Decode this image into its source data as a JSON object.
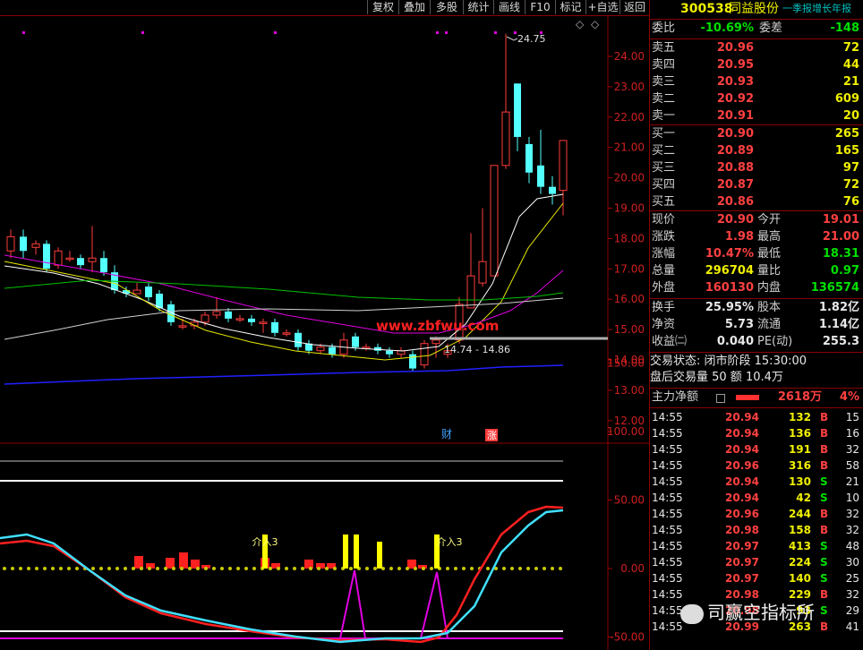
{
  "toolbar": [
    "复权",
    "叠加",
    "多股",
    "统计",
    "画线",
    "F10",
    "标记",
    "+自选",
    "返回"
  ],
  "header": {
    "code": "300538",
    "name": "同益股份",
    "subtitle": "一季报增长年报"
  },
  "quote": {
    "wei_bi_label": "委比",
    "wei_bi": "-10.69%",
    "wei_cha_label": "委差",
    "wei_cha": "-148",
    "asks": [
      {
        "label": "卖五",
        "price": "20.96",
        "vol": "72"
      },
      {
        "label": "卖四",
        "price": "20.95",
        "vol": "44"
      },
      {
        "label": "卖三",
        "price": "20.93",
        "vol": "21"
      },
      {
        "label": "卖二",
        "price": "20.92",
        "vol": "609"
      },
      {
        "label": "卖一",
        "price": "20.91",
        "vol": "20"
      }
    ],
    "bids": [
      {
        "label": "买一",
        "price": "20.90",
        "vol": "265"
      },
      {
        "label": "买二",
        "price": "20.89",
        "vol": "165"
      },
      {
        "label": "买三",
        "price": "20.88",
        "vol": "97"
      },
      {
        "label": "买四",
        "price": "20.87",
        "vol": "72"
      },
      {
        "label": "买五",
        "price": "20.86",
        "vol": "76"
      }
    ],
    "stats": [
      {
        "l1": "现价",
        "v1": "20.90",
        "c1": "red",
        "l2": "今开",
        "v2": "19.01",
        "c2": "red"
      },
      {
        "l1": "涨跌",
        "v1": "1.98",
        "c1": "red",
        "l2": "最高",
        "v2": "21.00",
        "c2": "red"
      },
      {
        "l1": "涨幅",
        "v1": "10.47%",
        "c1": "red",
        "l2": "最低",
        "v2": "18.31",
        "c2": "green"
      },
      {
        "l1": "总量",
        "v1": "296704",
        "c1": "yellow",
        "l2": "量比",
        "v2": "0.97",
        "c2": "green"
      },
      {
        "l1": "外盘",
        "v1": "160130",
        "c1": "red",
        "l2": "内盘",
        "v2": "136574",
        "c2": "green"
      }
    ],
    "stats2": [
      {
        "l1": "换手",
        "v1": "25.95%",
        "l2": "股本",
        "v2": "1.82亿"
      },
      {
        "l1": "净资",
        "v1": "5.73",
        "l2": "流通",
        "v2": "1.14亿"
      },
      {
        "l1": "收益㈡",
        "v1": "0.040",
        "l2": "PE(动)",
        "v2": "255.3"
      }
    ],
    "trade_state": "交易状态: 闭市阶段 15:30:00",
    "after_hours": "盘后交易量 50 额 10.4万",
    "main_force_label": "主力净额",
    "main_force_value": "2618万",
    "main_force_pct": "4%"
  },
  "ticks": [
    {
      "t": "14:55",
      "p": "20.94",
      "v": "132",
      "s": "B",
      "n": "15"
    },
    {
      "t": "14:55",
      "p": "20.94",
      "v": "136",
      "s": "B",
      "n": "16"
    },
    {
      "t": "14:55",
      "p": "20.94",
      "v": "191",
      "s": "B",
      "n": "32"
    },
    {
      "t": "14:55",
      "p": "20.96",
      "v": "316",
      "s": "B",
      "n": "58"
    },
    {
      "t": "14:55",
      "p": "20.94",
      "v": "130",
      "s": "S",
      "n": "21"
    },
    {
      "t": "14:55",
      "p": "20.94",
      "v": "42",
      "s": "S",
      "n": "10"
    },
    {
      "t": "14:55",
      "p": "20.96",
      "v": "244",
      "s": "B",
      "n": "32"
    },
    {
      "t": "14:55",
      "p": "20.98",
      "v": "158",
      "s": "B",
      "n": "32"
    },
    {
      "t": "14:55",
      "p": "20.97",
      "v": "413",
      "s": "S",
      "n": "48"
    },
    {
      "t": "14:55",
      "p": "20.97",
      "v": "224",
      "s": "S",
      "n": "30"
    },
    {
      "t": "14:55",
      "p": "20.97",
      "v": "140",
      "s": "S",
      "n": "25"
    },
    {
      "t": "14:55",
      "p": "20.98",
      "v": "229",
      "s": "B",
      "n": "32"
    },
    {
      "t": "14:55",
      "p": "20.98",
      "v": "93",
      "s": "S",
      "n": "29"
    },
    {
      "t": "14:55",
      "p": "20.99",
      "v": "263",
      "s": "B",
      "n": "41"
    }
  ],
  "chart": {
    "price_ticks": [
      "24.00",
      "23.00",
      "22.00",
      "21.00",
      "20.00",
      "19.00",
      "18.00",
      "17.00",
      "16.00",
      "15.00",
      "14.00",
      "13.00",
      "12.00"
    ],
    "ind_ticks": [
      "150.00",
      "100.00",
      "50.00",
      "0.00",
      "-50.00"
    ],
    "high_label": "24.75",
    "low_label": "14.74 - 14.86",
    "website": "www.zbfwu.com",
    "signal_label": "介入3",
    "marker_cai": "财",
    "marker_zhang": "涨"
  },
  "watermark": "司赢空指标所"
}
